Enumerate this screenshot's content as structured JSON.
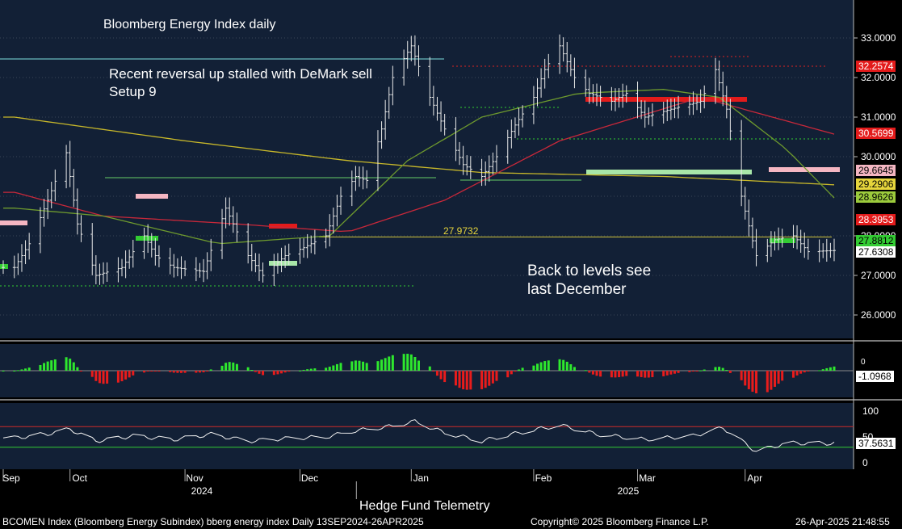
{
  "annotations": {
    "title": "Bloomberg Energy Index daily",
    "note1": "Recent reversal up stalled with DeMark sell",
    "note1b": "Setup 9",
    "note2": "Back to levels see",
    "note2b": "last December",
    "level_label": "27.9732",
    "source": "Hedge Fund Telemetry"
  },
  "footer": {
    "left": "BCOMEN Index (Bloomberg Energy Subindex) bberg energy index  Daily 13SEP2024-26APR2025",
    "center": "Copyright© 2025 Bloomberg Finance L.P.",
    "right": "26-Apr-2025 21:48:55"
  },
  "axis": {
    "months": [
      "Sep",
      "Oct",
      "Nov",
      "Dec",
      "Jan",
      "Feb",
      "Mar",
      "Apr"
    ],
    "years": [
      "2024",
      "2025"
    ]
  },
  "price_labels": [
    {
      "text": "32.2574",
      "bg": "#e31b1b",
      "fg": "#ffffff"
    },
    {
      "text": "30.5699",
      "bg": "#e31b1b",
      "fg": "#ffffff"
    },
    {
      "text": "29.6645",
      "bg": "#f4b6c2",
      "fg": "#000000"
    },
    {
      "text": "29.2906",
      "bg": "#e6d53c",
      "fg": "#000000"
    },
    {
      "text": "28.9626",
      "bg": "#9ccb3c",
      "fg": "#000000"
    },
    {
      "text": "28.3953",
      "bg": "#e31b1b",
      "fg": "#ffffff"
    },
    {
      "text": "27.8812",
      "bg": "#33cc33",
      "fg": "#000000"
    },
    {
      "text": "27.6308",
      "bg": "#ffffff",
      "fg": "#000000"
    }
  ],
  "colors": {
    "panel_bg": "#122036",
    "up": "#2ee82e",
    "down": "#e81c1c",
    "ma_yellow": "#c8b82a",
    "ma_red": "#c8283a",
    "ma_green": "#6e9a2e"
  },
  "chart_data": [
    {
      "type": "candlestick",
      "title": "Bloomberg Energy Index daily",
      "ylim": [
        25.5,
        33.5
      ],
      "yticks": [
        26.0,
        27.0,
        28.0,
        29.0,
        30.0,
        31.0,
        32.0,
        33.0
      ],
      "key_level": 27.9732,
      "anchors": [
        [
          "2024-09-16",
          27.2
        ],
        [
          "2024-09-20",
          27.8
        ],
        [
          "2024-09-25",
          28.9
        ],
        [
          "2024-09-30",
          30.1
        ],
        [
          "2024-10-03",
          28.3
        ],
        [
          "2024-10-08",
          27.0
        ],
        [
          "2024-10-15",
          27.2
        ],
        [
          "2024-10-21",
          28.0
        ],
        [
          "2024-10-24",
          27.5
        ],
        [
          "2024-10-29",
          27.2
        ],
        [
          "2024-11-06",
          27.1
        ],
        [
          "2024-11-12",
          28.7
        ],
        [
          "2024-11-18",
          27.5
        ],
        [
          "2024-11-22",
          27.0
        ],
        [
          "2024-11-28",
          27.5
        ],
        [
          "2024-12-03",
          27.7
        ],
        [
          "2024-12-09",
          28.0
        ],
        [
          "2024-12-13",
          29.0
        ],
        [
          "2024-12-17",
          29.5
        ],
        [
          "2024-12-20",
          29.4
        ],
        [
          "2024-12-24",
          30.7
        ],
        [
          "2024-12-27",
          32.0
        ],
        [
          "2025-01-01",
          32.8
        ],
        [
          "2025-01-06",
          31.5
        ],
        [
          "2025-01-10",
          30.7
        ],
        [
          "2025-01-15",
          29.8
        ],
        [
          "2025-01-20",
          29.5
        ],
        [
          "2025-01-24",
          30.0
        ],
        [
          "2025-01-29",
          30.8
        ],
        [
          "2025-02-03",
          31.5
        ],
        [
          "2025-02-06",
          32.2
        ],
        [
          "2025-02-10",
          32.8
        ],
        [
          "2025-02-14",
          32.0
        ],
        [
          "2025-02-18",
          31.6
        ],
        [
          "2025-02-24",
          31.4
        ],
        [
          "2025-02-28",
          31.6
        ],
        [
          "2025-03-05",
          31.0
        ],
        [
          "2025-03-12",
          31.2
        ],
        [
          "2025-03-20",
          31.4
        ],
        [
          "2025-03-24",
          32.2
        ],
        [
          "2025-03-27",
          31.2
        ],
        [
          "2025-03-31",
          29.0
        ],
        [
          "2025-04-04",
          27.5
        ],
        [
          "2025-04-09",
          27.9
        ],
        [
          "2025-04-14",
          28.0
        ],
        [
          "2025-04-18",
          27.6
        ],
        [
          "2025-04-25",
          27.63
        ]
      ],
      "series": [
        {
          "name": "",
          "color": "#c8b82a",
          "anchors": [
            [
              "2024-09-16",
              31.0
            ],
            [
              "2024-11-01",
              30.4
            ],
            [
              "2024-12-15",
              29.9
            ],
            [
              "2025-01-20",
              29.6
            ],
            [
              "2025-03-10",
              29.5
            ],
            [
              "2025-04-25",
              29.29
            ]
          ]
        },
        {
          "name": "",
          "color": "#c8283a",
          "anchors": [
            [
              "2024-09-16",
              29.1
            ],
            [
              "2024-10-10",
              28.5
            ],
            [
              "2024-11-15",
              28.3
            ],
            [
              "2024-12-15",
              28.1
            ],
            [
              "2025-01-10",
              28.9
            ],
            [
              "2025-02-10",
              30.4
            ],
            [
              "2025-03-20",
              31.5
            ],
            [
              "2025-04-25",
              30.57
            ]
          ]
        },
        {
          "name": "",
          "color": "#6e9a2e",
          "anchors": [
            [
              "2024-09-16",
              28.7
            ],
            [
              "2024-10-10",
              28.5
            ],
            [
              "2024-11-10",
              27.8
            ],
            [
              "2024-12-10",
              28.0
            ],
            [
              "2024-12-31",
              29.9
            ],
            [
              "2025-01-20",
              31.0
            ],
            [
              "2025-02-15",
              31.6
            ],
            [
              "2025-03-10",
              31.7
            ],
            [
              "2025-03-25",
              31.5
            ],
            [
              "2025-04-12",
              30.2
            ],
            [
              "2025-04-25",
              28.96
            ]
          ]
        }
      ]
    },
    {
      "type": "bar",
      "name": "",
      "last_value": -1.0968,
      "yticks": [
        0
      ]
    },
    {
      "type": "line",
      "name": "",
      "ylim": [
        -10,
        110
      ],
      "yticks": [
        0,
        50,
        100
      ],
      "levels": [
        70,
        30
      ],
      "last_value": 37.5631,
      "anchors": [
        [
          "2024-09-16",
          48
        ],
        [
          "2024-09-25",
          56
        ],
        [
          "2024-10-01",
          65
        ],
        [
          "2024-10-08",
          42
        ],
        [
          "2024-10-18",
          52
        ],
        [
          "2024-10-29",
          45
        ],
        [
          "2024-11-08",
          55
        ],
        [
          "2024-11-18",
          42
        ],
        [
          "2024-11-28",
          47
        ],
        [
          "2024-12-09",
          50
        ],
        [
          "2024-12-17",
          62
        ],
        [
          "2024-12-26",
          70
        ],
        [
          "2025-01-02",
          80
        ],
        [
          "2025-01-10",
          58
        ],
        [
          "2025-01-20",
          42
        ],
        [
          "2025-01-28",
          55
        ],
        [
          "2025-02-10",
          73
        ],
        [
          "2025-02-20",
          55
        ],
        [
          "2025-03-05",
          45
        ],
        [
          "2025-03-18",
          52
        ],
        [
          "2025-03-26",
          68
        ],
        [
          "2025-04-04",
          22
        ],
        [
          "2025-04-12",
          38
        ],
        [
          "2025-04-25",
          37.56
        ]
      ]
    }
  ]
}
